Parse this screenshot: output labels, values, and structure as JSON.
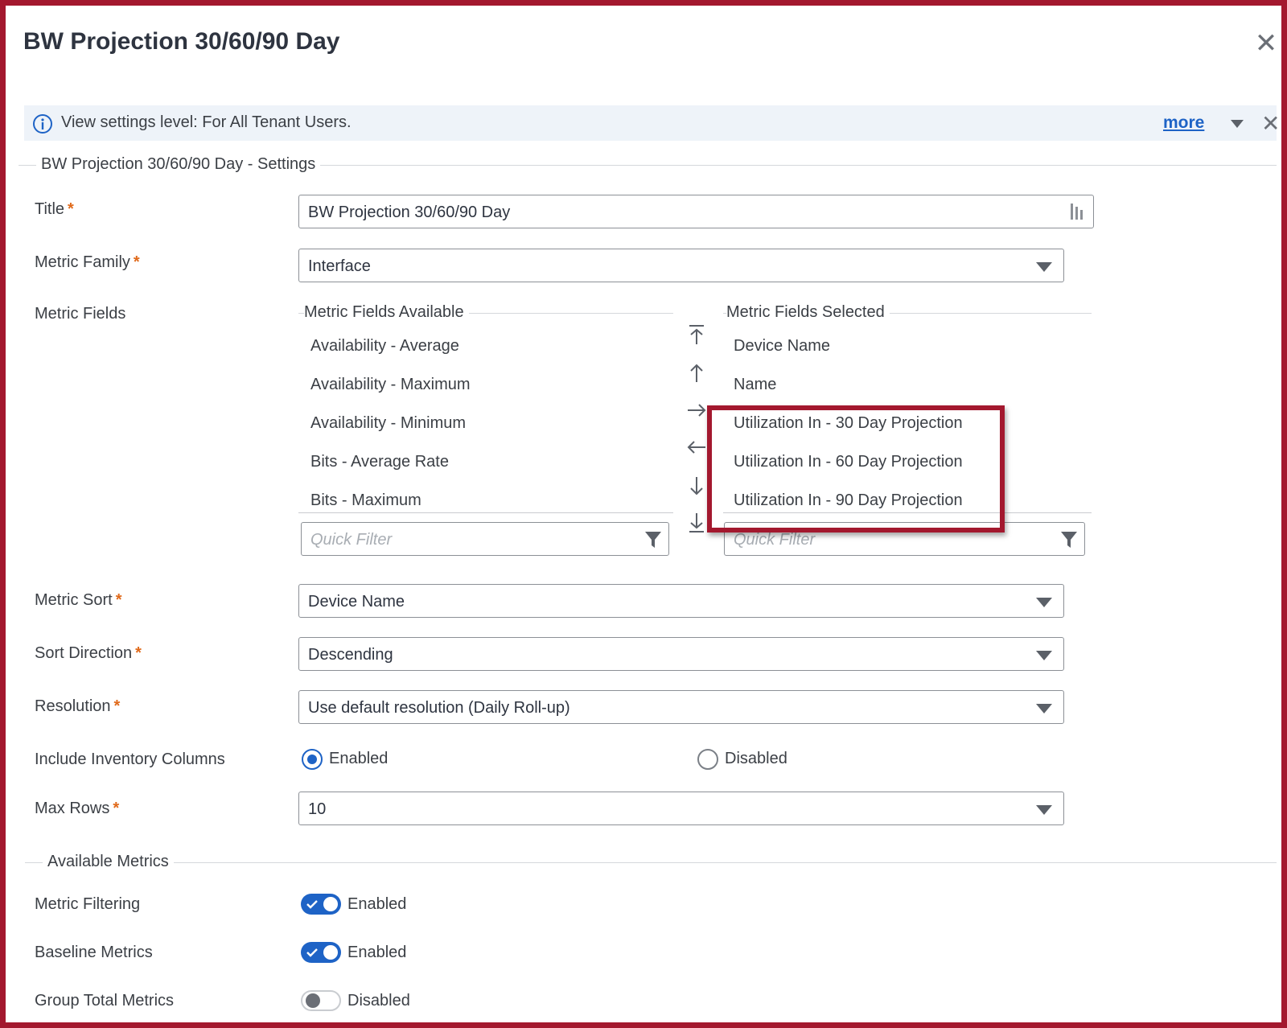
{
  "dialog": {
    "title": "BW Projection 30/60/90 Day",
    "close_icon": "close-icon"
  },
  "banner": {
    "text": "View settings level: For All Tenant Users.",
    "more_label": "more",
    "icon": "info-icon"
  },
  "settings": {
    "legend": "BW Projection 30/60/90 Day - Settings",
    "title_label": "Title",
    "title_value": "BW Projection 30/60/90 Day",
    "metric_family_label": "Metric Family",
    "metric_family_value": "Interface",
    "metric_fields_label": "Metric Fields",
    "available": {
      "legend": "Metric Fields Available",
      "items": [
        "Availability - Average",
        "Availability - Maximum",
        "Availability - Minimum",
        "Bits - Average Rate",
        "Bits - Maximum"
      ],
      "filter_placeholder": "Quick Filter"
    },
    "selected": {
      "legend": "Metric Fields Selected",
      "items": [
        "Device Name",
        "Name",
        "Utilization In - 30 Day Projection",
        "Utilization In - 60 Day Projection",
        "Utilization In - 90 Day Projection"
      ],
      "filter_placeholder": "Quick Filter"
    },
    "metric_sort_label": "Metric Sort",
    "metric_sort_value": "Device Name",
    "sort_direction_label": "Sort Direction",
    "sort_direction_value": "Descending",
    "resolution_label": "Resolution",
    "resolution_value": "Use default resolution (Daily Roll-up)",
    "inventory_label": "Include Inventory Columns",
    "inventory_enabled_label": "Enabled",
    "inventory_disabled_label": "Disabled",
    "inventory_selected": "Enabled",
    "max_rows_label": "Max Rows",
    "max_rows_value": "10"
  },
  "available_metrics": {
    "legend": "Available Metrics",
    "metric_filtering_label": "Metric Filtering",
    "metric_filtering_state": "Enabled",
    "baseline_label": "Baseline Metrics",
    "baseline_state": "Enabled",
    "group_total_label": "Group Total Metrics",
    "group_total_state": "Disabled"
  },
  "colors": {
    "accent": "#1e63c6",
    "frame": "#a3182e",
    "required": "#e06a1b"
  }
}
